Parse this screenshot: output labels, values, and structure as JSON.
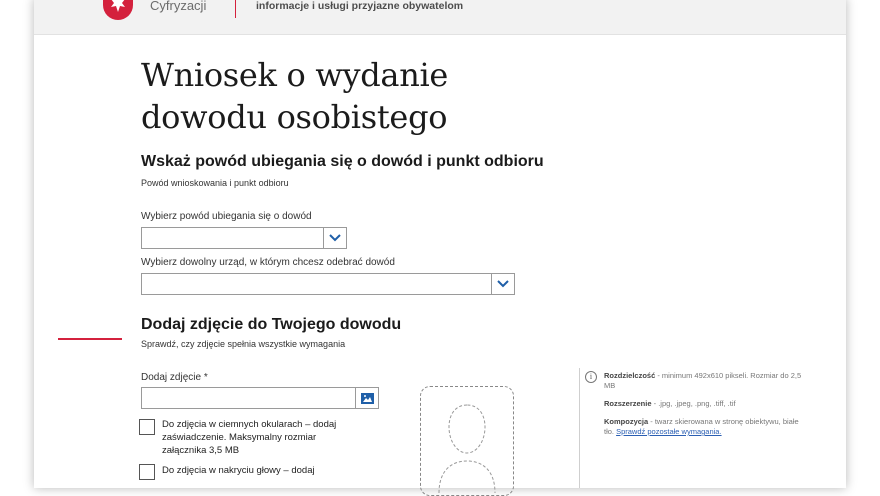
{
  "header": {
    "ministry_fragment": "Cyfryzacji",
    "tagline": "informacje i usługi przyjazne obywatelom"
  },
  "page_title_line1": "Wniosek o wydanie",
  "page_title_line2": "dowodu osobistego",
  "section1": {
    "heading": "Wskaż powód ubiegania się o dowód i punkt odbioru",
    "subheading": "Powód wnioskowania i punkt odbioru",
    "reason_label": "Wybierz powód ubiegania się o dowód",
    "reason_value": "",
    "office_label": "Wybierz dowolny urząd, w którym chcesz odebrać dowód",
    "office_value": ""
  },
  "section2": {
    "heading": "Dodaj zdjęcie do Twojego dowodu",
    "subheading": "Sprawdź, czy zdjęcie spełnia wszystkie wymagania",
    "photo_label": "Dodaj zdjęcie *",
    "photo_value": "",
    "checkbox1_text": "Do zdjęcia w ciemnych okularach – dodaj zaświadczenie. Maksymalny rozmiar załącznika 3,5 MB",
    "checkbox2_text": "Do zdjęcia w nakryciu głowy – dodaj",
    "requirements": {
      "resolution_label": "Rozdzielczość",
      "resolution_text": " - minimum 492x610 pikseli. Rozmiar do 2,5 MB",
      "extension_label": "Rozszerzenie",
      "extension_text": " - .jpg, .jpeg, .png, .tiff, .tif",
      "composition_label": "Kompozycja",
      "composition_text": " - twarz skierowana w stronę obiektywu, białe tło. ",
      "check_link": "Sprawdź pozostałe wymagania."
    }
  },
  "colors": {
    "accent_red": "#d4213d",
    "link_blue": "#2b5fb3",
    "chevron_blue": "#1f5fa8"
  },
  "icons": [
    "poland-eagle-emblem-icon",
    "chevron-down-icon",
    "image-upload-icon",
    "info-icon",
    "person-silhouette-icon"
  ]
}
